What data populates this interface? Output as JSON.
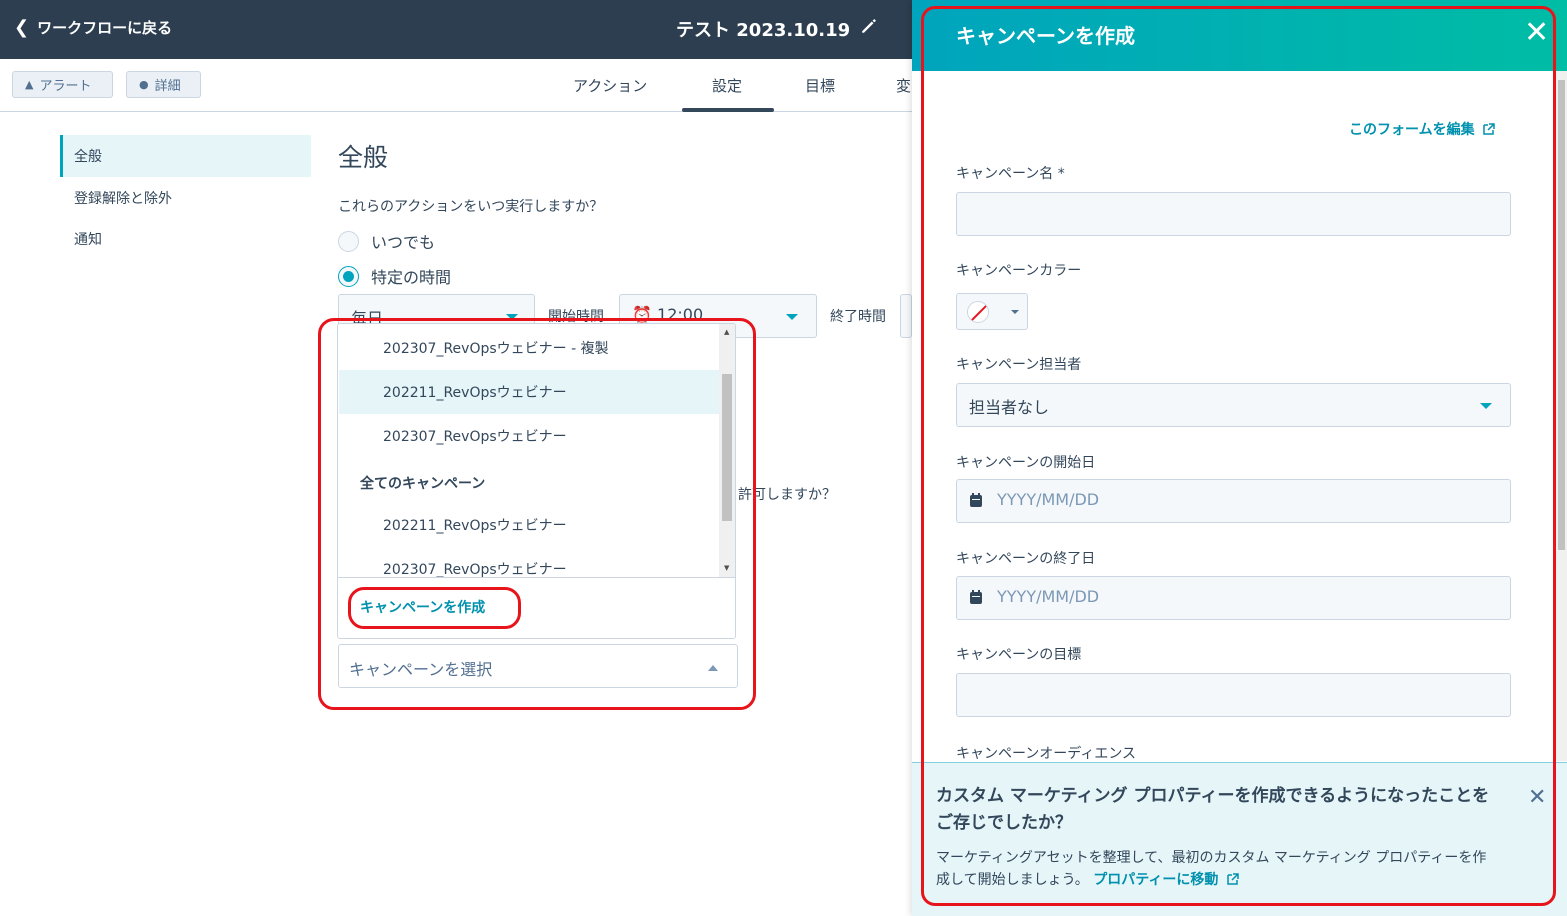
{
  "topbar": {
    "back_label": "ワークフローに戻る",
    "workflow_title": "テスト 2023.10.19"
  },
  "subbar": {
    "alert_label": "アラート",
    "details_label": "詳細",
    "tabs": [
      {
        "label": "アクション"
      },
      {
        "label": "設定"
      },
      {
        "label": "目標"
      },
      {
        "label": "変"
      }
    ]
  },
  "left_nav": {
    "items": [
      {
        "label": "全般"
      },
      {
        "label": "登録解除と除外"
      },
      {
        "label": "通知"
      }
    ]
  },
  "general": {
    "title": "全般",
    "question": "これらのアクションをいつ実行しますか？",
    "radio_anytime": "いつでも",
    "radio_specific": "特定の時間",
    "frequency_value": "毎日",
    "start_time_label": "開始時間",
    "start_time_value": "12:00",
    "end_time_label": "終了時間",
    "partial_question": "許可しますか？"
  },
  "dropdown": {
    "items_top": [
      {
        "label": "202307_RevOpsウェビナー - 複製"
      },
      {
        "label": "202211_RevOpsウェビナー"
      },
      {
        "label": "202307_RevOpsウェビナー"
      }
    ],
    "group_label": "全てのキャンペーン",
    "items_group": [
      {
        "label": "202211_RevOpsウェビナー"
      },
      {
        "label": "202307_RevOpsウェビナー"
      }
    ],
    "create_label": "キャンペーンを作成",
    "select_placeholder": "キャンペーンを選択"
  },
  "panel": {
    "title": "キャンペーンを作成",
    "edit_form_link": "このフォームを編集",
    "name_label": "キャンペーン名 *",
    "color_label": "キャンペーンカラー",
    "owner_label": "キャンペーン担当者",
    "owner_value": "担当者なし",
    "start_label": "キャンペーンの開始日",
    "start_placeholder": "YYYY/MM/DD",
    "end_label": "キャンペーンの終了日",
    "end_placeholder": "YYYY/MM/DD",
    "goal_label": "キャンペーンの目標",
    "audience_label": "キャンペーンオーディエンス"
  },
  "notice": {
    "title": "カスタム マーケティング プロパティーを作成できるようになったことをご存じでしたか？",
    "body": "マーケティングアセットを整理して、最初のカスタム マーケティング プロパティーを作成して開始しましょう。",
    "link": "プロパティーに移動"
  },
  "colors": {
    "header_dark": "#2d3e50",
    "accent": "#00a4bd",
    "link": "#0091ae",
    "annotation": "#e8141c"
  }
}
